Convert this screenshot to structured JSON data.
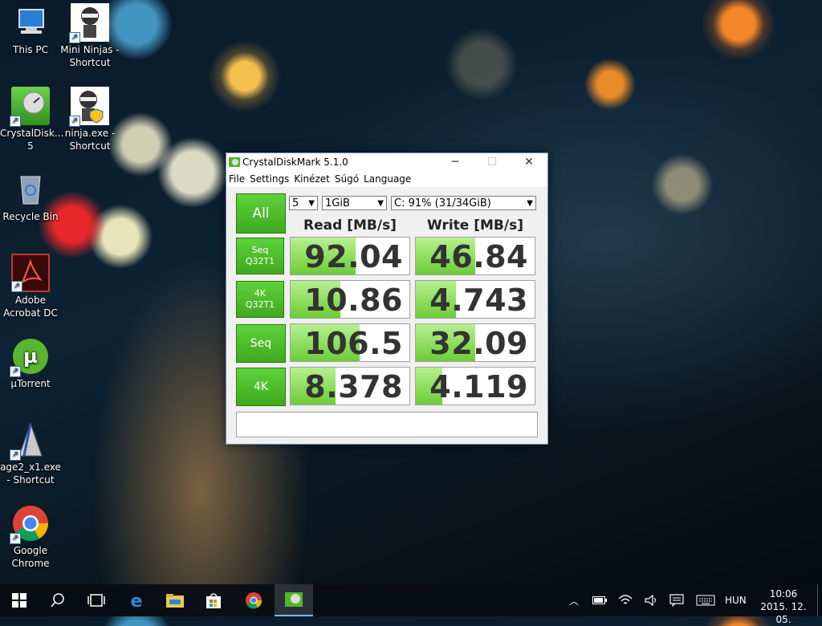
{
  "desktop": {
    "icons": [
      {
        "label": "This PC",
        "icon": "this-pc-icon"
      },
      {
        "label": "Mini Ninjas - Shortcut",
        "icon": "mini-ninjas-icon"
      },
      {
        "label": "CrystalDisk... 5",
        "icon": "crystaldisk-icon"
      },
      {
        "label": "ninja.exe - Shortcut",
        "icon": "ninja-exe-icon"
      },
      {
        "label": "Recycle Bin",
        "icon": "recycle-bin-icon"
      },
      {
        "label": "Adobe Acrobat DC",
        "icon": "adobe-acrobat-icon"
      },
      {
        "label": "μTorrent",
        "icon": "utorrent-icon"
      },
      {
        "label": "age2_x1.exe - Shortcut",
        "icon": "age2-icon"
      },
      {
        "label": "Google Chrome",
        "icon": "chrome-icon"
      }
    ]
  },
  "window": {
    "title": "CrystalDiskMark 5.1.0",
    "menu": [
      "File",
      "Settings",
      "Kinézet",
      "Súgó",
      "Language"
    ],
    "all_button": "All",
    "count_select": "5",
    "size_select": "1GiB",
    "drive_select": "C: 91% (31/34GiB)",
    "read_header": "Read [MB/s]",
    "write_header": "Write [MB/s]",
    "rows": [
      {
        "label_line1": "Seq",
        "label_line2": "Q32T1",
        "read": "92.04",
        "write": "46.84",
        "read_fill": 0.55,
        "write_fill": 0.5
      },
      {
        "label_line1": "4K",
        "label_line2": "Q32T1",
        "read": "10.86",
        "write": "4.743",
        "read_fill": 0.42,
        "write_fill": 0.34
      },
      {
        "label_line1": "Seq",
        "label_line2": "",
        "read": "106.5",
        "write": "32.09",
        "read_fill": 0.58,
        "write_fill": 0.5
      },
      {
        "label_line1": "4K",
        "label_line2": "",
        "read": "8.378",
        "write": "4.119",
        "read_fill": 0.38,
        "write_fill": 0.22
      }
    ],
    "status_text": ""
  },
  "taskbar": {
    "language": "HUN",
    "time": "10:06",
    "date": "2015. 12. 05."
  }
}
